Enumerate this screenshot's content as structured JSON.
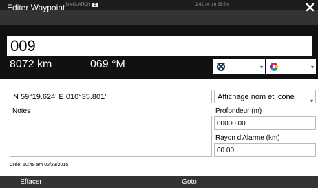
{
  "statusbar": {
    "mode": "SIMULATION",
    "sog_label": "S",
    "sog_value": "",
    "time": "2:41:14 pm",
    "depth": "26.6m"
  },
  "dialog": {
    "title": "Editer Waypoint",
    "close_icon": "close-icon"
  },
  "waypoint": {
    "name": "009",
    "distance": "8072 km",
    "bearing": "069 °M",
    "symbol_icon": "waypoint-cross-icon",
    "color_icon": "color-wheel-icon",
    "position": "N 59°19.624'  E 010°35.801'",
    "display_option": "Affichage nom et icone",
    "depth_label": "Profondeur (m)",
    "depth_value": "00000.00",
    "alarm_label": "Rayon d'Alarme (km)",
    "alarm_value": "00.00",
    "notes_label": "Notes",
    "notes_value": "",
    "created": "Créé: 10:49 am  02/23/2015"
  },
  "actions": {
    "delete_label": "Effacer",
    "goto_label": "Goto"
  },
  "colors": {
    "titlebar": "#333333",
    "darkband": "#111111",
    "accent_red": "#d32f2f",
    "accent_yellow": "#f4c20d",
    "accent_green": "#0f9d58",
    "accent_blue": "#4285f4"
  }
}
